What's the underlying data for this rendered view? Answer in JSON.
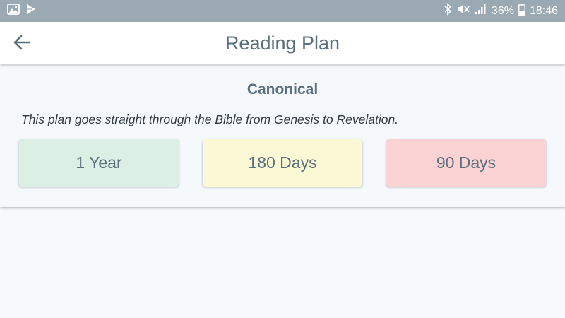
{
  "status_bar": {
    "left_icons": [
      "image-icon",
      "play-store-icon"
    ],
    "right_icons": [
      "bluetooth-icon",
      "mute-icon",
      "signal-icon",
      "battery-icon"
    ],
    "battery_percent": "36%",
    "time": "18:46"
  },
  "app_bar": {
    "title": "Reading Plan",
    "back_icon": "arrow-left-icon"
  },
  "plan": {
    "title": "Canonical",
    "description": "This plan goes straight through the Bible from Genesis to Revelation.",
    "options": [
      {
        "label": "1 Year",
        "color": "#dcefe4"
      },
      {
        "label": "180 Days",
        "color": "#fbf8d6"
      },
      {
        "label": "90 Days",
        "color": "#fbd3d4"
      }
    ]
  },
  "colors": {
    "status_bar": "#9aa9b2",
    "accent_text": "#5a6f7c",
    "background": "#f7fafd"
  }
}
